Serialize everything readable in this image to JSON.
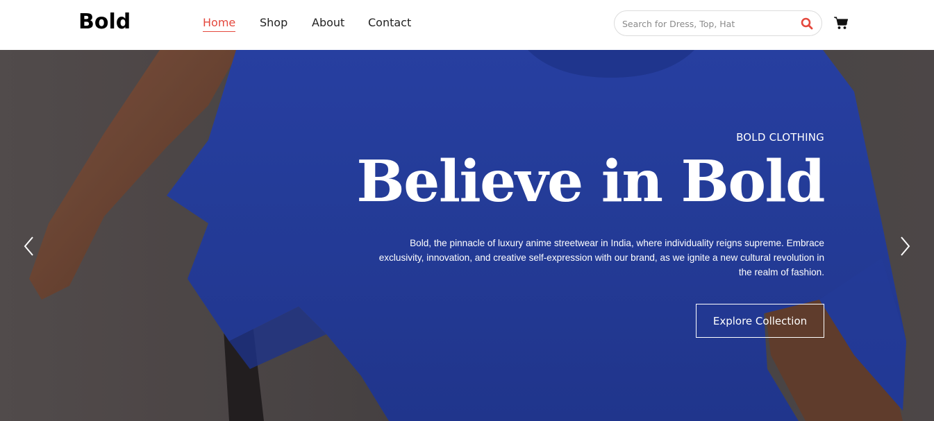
{
  "header": {
    "logo": "Bold",
    "nav": [
      {
        "label": "Home",
        "active": true
      },
      {
        "label": "Shop",
        "active": false
      },
      {
        "label": "About",
        "active": false
      },
      {
        "label": "Contact",
        "active": false
      }
    ],
    "search": {
      "placeholder": "Search for Dress, Top, Hat",
      "value": ""
    },
    "icons": {
      "search": "search-icon",
      "cart": "cart-icon"
    }
  },
  "hero": {
    "eyebrow": "BOLD CLOTHING",
    "headline": "Believe in Bold",
    "description": "Bold, the pinnacle of luxury anime streetwear in India, where individuality reigns supreme. Embrace exclusivity, innovation, and creative self-expression with our brand, as we ignite a new cultural revolution in the realm of fashion.",
    "cta": "Explore Collection",
    "prev_icon": "chevron-left-icon",
    "next_icon": "chevron-right-icon"
  },
  "colors": {
    "accent": "#e4483d",
    "shirt": "#2f49b5",
    "text": "#222222",
    "white": "#ffffff"
  }
}
